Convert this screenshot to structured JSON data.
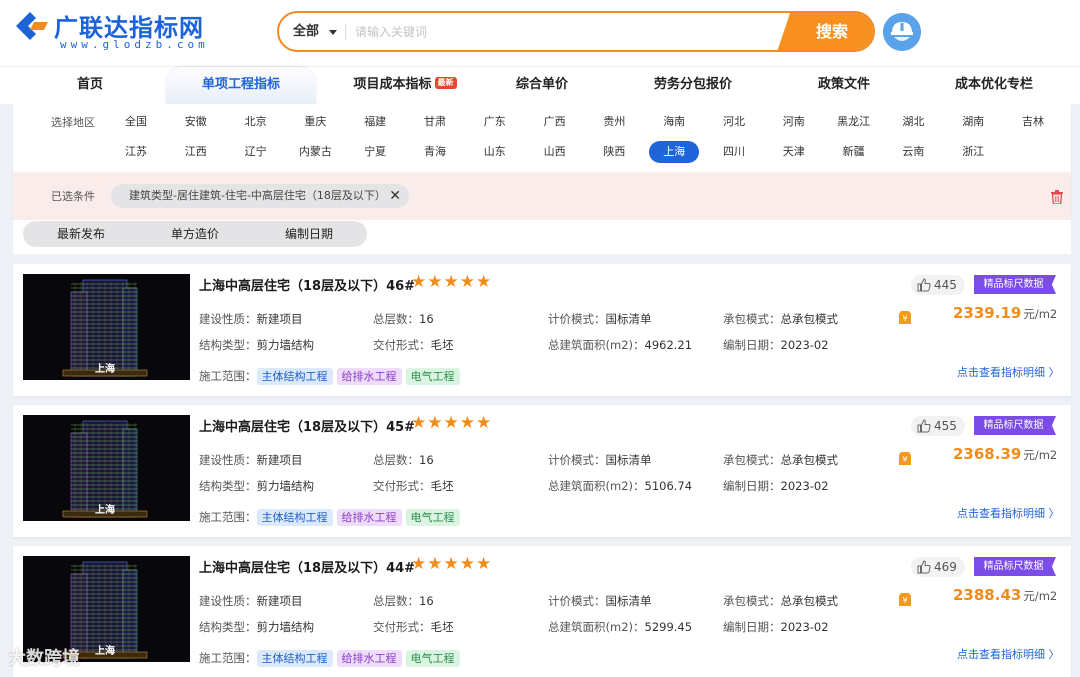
{
  "logo": {
    "title": "广联达指标网",
    "subtitle": "www.glodzb.com"
  },
  "search": {
    "scope": "全部",
    "placeholder": "请输入关键词",
    "button": "搜索"
  },
  "nav": {
    "items": [
      {
        "label": "首页"
      },
      {
        "label": "单项工程指标"
      },
      {
        "label": "项目成本指标",
        "badge": "最新"
      },
      {
        "label": "综合单价"
      },
      {
        "label": "劳务分包报价"
      },
      {
        "label": "政策文件"
      },
      {
        "label": "成本优化专栏"
      }
    ],
    "active": "单项工程指标"
  },
  "region": {
    "label": "选择地区",
    "row1": [
      "全国",
      "安徽",
      "北京",
      "重庆",
      "福建",
      "甘肃",
      "广东",
      "广西",
      "贵州",
      "海南",
      "河北",
      "河南",
      "黑龙江",
      "湖北",
      "湖南",
      "吉林"
    ],
    "row2": [
      "江苏",
      "江西",
      "辽宁",
      "内蒙古",
      "宁夏",
      "青海",
      "山东",
      "山西",
      "陕西",
      "上海",
      "四川",
      "天津",
      "新疆",
      "云南",
      "浙江"
    ],
    "selected": "上海"
  },
  "conditions": {
    "label": "已选条件",
    "chip": "建筑类型-居住建筑-住宅-中高层住宅（18层及以下）",
    "chip_close": "✕"
  },
  "sort": {
    "items": [
      "最新发布",
      "单方造价",
      "编制日期"
    ]
  },
  "labels": {
    "nature": "建设性质：",
    "floors": "总层数：",
    "pricing": "计价模式：",
    "contract": "承包模式：",
    "structure": "结构类型：",
    "delivery": "交付形式：",
    "area": "总建筑面积(m2)：",
    "date": "编制日期：",
    "scope": "施工范围：",
    "premium": "精品标尺数据",
    "detail": "点击查看指标明细 〉",
    "stars": "★★★★★",
    "unit": "元/m2"
  },
  "cards": [
    {
      "city": "上海",
      "title": "上海中高层住宅（18层及以下）46#",
      "nature": "新建项目",
      "floors": "16",
      "pricing": "国标清单",
      "contract": "总承包模式",
      "structure": "剪力墙结构",
      "delivery": "毛坯",
      "area": "4962.21",
      "date": "2023-02",
      "scope": [
        "主体结构工程",
        "给排水工程",
        "电气工程"
      ],
      "likes": "445",
      "price": "2339.19"
    },
    {
      "city": "上海",
      "title": "上海中高层住宅（18层及以下）45#",
      "nature": "新建项目",
      "floors": "16",
      "pricing": "国标清单",
      "contract": "总承包模式",
      "structure": "剪力墙结构",
      "delivery": "毛坯",
      "area": "5106.74",
      "date": "2023-02",
      "scope": [
        "主体结构工程",
        "给排水工程",
        "电气工程"
      ],
      "likes": "455",
      "price": "2368.39"
    },
    {
      "city": "上海",
      "title": "上海中高层住宅（18层及以下）44#",
      "nature": "新建项目",
      "floors": "16",
      "pricing": "国标清单",
      "contract": "总承包模式",
      "structure": "剪力墙结构",
      "delivery": "毛坯",
      "area": "5299.45",
      "date": "2023-02",
      "scope": [
        "主体结构工程",
        "给排水工程",
        "电气工程"
      ],
      "likes": "469",
      "price": "2388.43"
    }
  ],
  "watermark": "大数跨境",
  "colors": {
    "brand_blue": "#1f64d8",
    "accent_orange": "#f08c1a",
    "premium_purple": "#7b4ce8",
    "selected_bg": "#fbecec"
  }
}
